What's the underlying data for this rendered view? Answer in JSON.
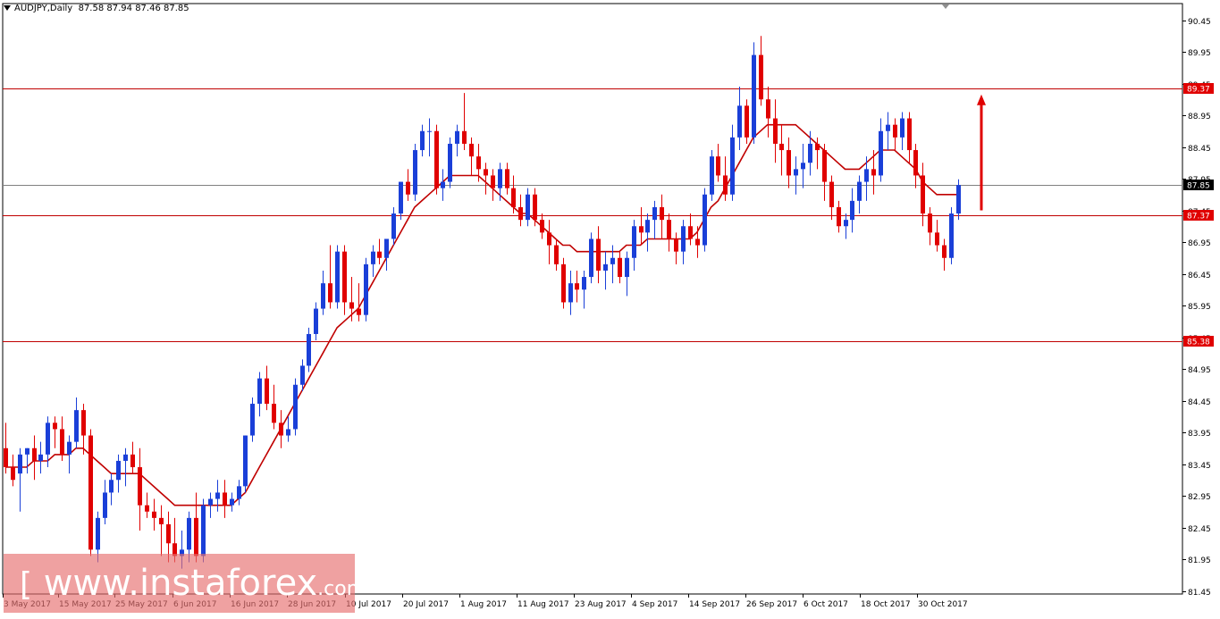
{
  "header": {
    "symbol": "AUDJPY,Daily",
    "ohlc": "87.58 87.94 87.46 87.85"
  },
  "watermark": {
    "open": "[",
    "text": " www.instaforex",
    "suffix": ".com",
    "close": " ]"
  },
  "colors": {
    "bull": "#1a3fd8",
    "bear": "#e00000",
    "level_line": "#c00000",
    "label_bg": "#e00000",
    "ma": "#c00000",
    "price_line": "#808080",
    "arrow": "#e00000"
  },
  "chart_data": {
    "type": "candlestick",
    "symbol": "AUDJPY",
    "timeframe": "Daily",
    "y_range": [
      81.45,
      90.45
    ],
    "y_ticks": [
      "90.45",
      "89.95",
      "89.45",
      "88.95",
      "88.45",
      "87.95",
      "87.45",
      "86.95",
      "86.45",
      "85.95",
      "85.45",
      "84.95",
      "84.45",
      "83.95",
      "83.45",
      "82.95",
      "82.45",
      "81.95",
      "81.45"
    ],
    "x_ticks": [
      "3 May 2017",
      "15 May 2017",
      "25 May 2017",
      "6 Jun 2017",
      "16 Jun 2017",
      "28 Jun 2017",
      "10 Jul 2017",
      "20 Jul 2017",
      "1 Aug 2017",
      "11 Aug 2017",
      "23 Aug 2017",
      "4 Sep 2017",
      "14 Sep 2017",
      "26 Sep 2017",
      "6 Oct 2017",
      "18 Oct 2017",
      "30 Oct 2017"
    ],
    "levels": [
      {
        "value": 89.37,
        "label": "89.37"
      },
      {
        "value": 87.37,
        "label": "87.37"
      },
      {
        "value": 85.38,
        "label": "85.38"
      }
    ],
    "current_price": {
      "value": 87.85,
      "label": "87.85"
    },
    "candles": [
      [
        83.7,
        84.1,
        83.3,
        83.4
      ],
      [
        83.4,
        83.6,
        83.1,
        83.2
      ],
      [
        83.3,
        83.7,
        82.7,
        83.6
      ],
      [
        83.6,
        83.7,
        83.3,
        83.7
      ],
      [
        83.7,
        83.9,
        83.2,
        83.5
      ],
      [
        83.5,
        83.8,
        83.3,
        83.6
      ],
      [
        83.6,
        84.2,
        83.4,
        84.1
      ],
      [
        84.1,
        84.2,
        83.7,
        84.0
      ],
      [
        84.0,
        84.2,
        83.5,
        83.6
      ],
      [
        83.6,
        83.9,
        83.3,
        83.8
      ],
      [
        83.8,
        84.5,
        83.7,
        84.3
      ],
      [
        84.3,
        84.4,
        83.6,
        83.9
      ],
      [
        83.9,
        84.0,
        82.0,
        82.1
      ],
      [
        82.1,
        82.7,
        81.9,
        82.6
      ],
      [
        82.6,
        83.2,
        82.5,
        83.0
      ],
      [
        83.0,
        83.3,
        82.8,
        83.2
      ],
      [
        83.2,
        83.6,
        83.0,
        83.5
      ],
      [
        83.5,
        83.7,
        83.1,
        83.6
      ],
      [
        83.6,
        83.8,
        83.3,
        83.4
      ],
      [
        83.4,
        83.7,
        82.4,
        82.8
      ],
      [
        82.8,
        83.0,
        82.6,
        82.7
      ],
      [
        82.7,
        82.9,
        82.4,
        82.6
      ],
      [
        82.6,
        82.8,
        82.0,
        82.5
      ],
      [
        82.5,
        82.7,
        81.9,
        82.2
      ],
      [
        82.2,
        82.6,
        81.9,
        82.0
      ],
      [
        82.0,
        82.4,
        81.8,
        82.1
      ],
      [
        82.1,
        82.7,
        81.9,
        82.6
      ],
      [
        82.6,
        83.0,
        81.9,
        82.0
      ],
      [
        82.0,
        82.9,
        81.9,
        82.8
      ],
      [
        82.8,
        83.0,
        82.6,
        82.9
      ],
      [
        82.9,
        83.2,
        82.7,
        83.0
      ],
      [
        83.0,
        83.2,
        82.6,
        82.8
      ],
      [
        82.8,
        83.0,
        82.7,
        82.9
      ],
      [
        82.9,
        83.2,
        82.8,
        83.1
      ],
      [
        83.1,
        83.9,
        83.0,
        83.9
      ],
      [
        83.9,
        84.5,
        83.8,
        84.4
      ],
      [
        84.4,
        84.9,
        84.2,
        84.8
      ],
      [
        84.8,
        85.0,
        84.3,
        84.4
      ],
      [
        84.4,
        84.7,
        84.0,
        84.1
      ],
      [
        84.1,
        84.3,
        83.7,
        83.9
      ],
      [
        83.9,
        84.2,
        83.8,
        84.0
      ],
      [
        84.0,
        84.8,
        83.9,
        84.7
      ],
      [
        84.7,
        85.1,
        84.6,
        85.0
      ],
      [
        85.0,
        85.6,
        84.9,
        85.5
      ],
      [
        85.5,
        86.0,
        85.4,
        85.9
      ],
      [
        85.9,
        86.5,
        85.8,
        86.3
      ],
      [
        86.3,
        86.9,
        85.9,
        86.0
      ],
      [
        86.0,
        86.9,
        85.9,
        86.8
      ],
      [
        86.8,
        86.9,
        85.8,
        86.0
      ],
      [
        86.0,
        86.4,
        85.7,
        85.9
      ],
      [
        85.9,
        86.3,
        85.7,
        85.8
      ],
      [
        85.8,
        86.7,
        85.7,
        86.6
      ],
      [
        86.6,
        86.9,
        86.4,
        86.8
      ],
      [
        86.8,
        87.0,
        86.6,
        86.7
      ],
      [
        86.7,
        87.0,
        86.5,
        87.0
      ],
      [
        87.0,
        87.5,
        86.9,
        87.4
      ],
      [
        87.4,
        87.9,
        87.3,
        87.9
      ],
      [
        87.9,
        88.1,
        87.6,
        87.7
      ],
      [
        87.7,
        88.5,
        87.6,
        88.4
      ],
      [
        88.4,
        88.8,
        88.3,
        88.7
      ],
      [
        88.7,
        88.9,
        88.3,
        88.7
      ],
      [
        88.7,
        88.8,
        87.7,
        87.8
      ],
      [
        87.8,
        88.1,
        87.6,
        87.9
      ],
      [
        87.9,
        88.6,
        87.8,
        88.5
      ],
      [
        88.5,
        88.8,
        88.3,
        88.7
      ],
      [
        88.7,
        89.3,
        88.4,
        88.5
      ],
      [
        88.5,
        88.6,
        88.0,
        88.3
      ],
      [
        88.3,
        88.5,
        87.9,
        88.1
      ],
      [
        88.1,
        88.2,
        87.7,
        88.0
      ],
      [
        88.0,
        88.1,
        87.6,
        87.8
      ],
      [
        87.8,
        88.2,
        87.6,
        88.1
      ],
      [
        88.1,
        88.2,
        87.7,
        87.8
      ],
      [
        87.8,
        88.0,
        87.4,
        87.5
      ],
      [
        87.5,
        87.7,
        87.2,
        87.3
      ],
      [
        87.3,
        87.8,
        87.2,
        87.7
      ],
      [
        87.7,
        87.8,
        87.2,
        87.3
      ],
      [
        87.3,
        87.4,
        87.0,
        87.1
      ],
      [
        87.1,
        87.3,
        86.6,
        86.9
      ],
      [
        86.9,
        87.0,
        86.5,
        86.6
      ],
      [
        86.6,
        86.7,
        85.9,
        86.0
      ],
      [
        86.0,
        86.5,
        85.8,
        86.3
      ],
      [
        86.3,
        86.5,
        86.0,
        86.2
      ],
      [
        86.2,
        86.5,
        85.9,
        86.4
      ],
      [
        86.4,
        87.1,
        86.3,
        87.0
      ],
      [
        87.0,
        87.2,
        86.3,
        86.5
      ],
      [
        86.5,
        86.8,
        86.2,
        86.6
      ],
      [
        86.6,
        86.9,
        86.3,
        86.7
      ],
      [
        86.7,
        86.8,
        86.3,
        86.4
      ],
      [
        86.4,
        86.8,
        86.1,
        86.7
      ],
      [
        86.7,
        87.3,
        86.5,
        87.2
      ],
      [
        87.2,
        87.5,
        86.9,
        87.1
      ],
      [
        87.1,
        87.4,
        86.8,
        87.3
      ],
      [
        87.3,
        87.6,
        87.0,
        87.5
      ],
      [
        87.5,
        87.7,
        87.0,
        87.3
      ],
      [
        87.3,
        87.4,
        86.8,
        87.0
      ],
      [
        87.0,
        87.1,
        86.6,
        86.8
      ],
      [
        86.8,
        87.3,
        86.6,
        87.2
      ],
      [
        87.2,
        87.4,
        86.9,
        87.0
      ],
      [
        87.0,
        87.2,
        86.7,
        86.9
      ],
      [
        86.9,
        87.8,
        86.8,
        87.7
      ],
      [
        87.7,
        88.4,
        87.6,
        88.3
      ],
      [
        88.3,
        88.5,
        87.9,
        88.0
      ],
      [
        88.0,
        88.3,
        87.6,
        87.7
      ],
      [
        87.7,
        88.8,
        87.6,
        88.6
      ],
      [
        88.6,
        89.4,
        88.4,
        89.1
      ],
      [
        89.1,
        89.2,
        88.5,
        88.6
      ],
      [
        88.6,
        90.1,
        88.5,
        89.9
      ],
      [
        89.9,
        90.2,
        89.1,
        89.2
      ],
      [
        89.2,
        89.4,
        88.6,
        88.9
      ],
      [
        88.9,
        89.2,
        88.2,
        88.5
      ],
      [
        88.5,
        88.8,
        88.0,
        88.4
      ],
      [
        88.4,
        88.6,
        87.8,
        88.0
      ],
      [
        88.0,
        88.3,
        87.7,
        88.1
      ],
      [
        88.1,
        88.5,
        87.8,
        88.2
      ],
      [
        88.2,
        88.7,
        88.0,
        88.5
      ],
      [
        88.5,
        88.6,
        88.1,
        88.4
      ],
      [
        88.4,
        88.5,
        87.6,
        87.9
      ],
      [
        87.9,
        88.0,
        87.3,
        87.5
      ],
      [
        87.5,
        87.6,
        87.1,
        87.2
      ],
      [
        87.2,
        87.4,
        87.0,
        87.3
      ],
      [
        87.3,
        87.8,
        87.1,
        87.6
      ],
      [
        87.6,
        88.0,
        87.4,
        87.9
      ],
      [
        87.9,
        88.3,
        87.6,
        88.1
      ],
      [
        88.1,
        88.4,
        87.7,
        88.0
      ],
      [
        88.0,
        88.9,
        87.9,
        88.7
      ],
      [
        88.7,
        89.0,
        88.4,
        88.8
      ],
      [
        88.8,
        88.9,
        88.4,
        88.6
      ],
      [
        88.6,
        89.0,
        88.4,
        88.9
      ],
      [
        88.9,
        89.0,
        88.2,
        88.4
      ],
      [
        88.4,
        88.5,
        87.8,
        88.0
      ],
      [
        88.0,
        88.2,
        87.2,
        87.4
      ],
      [
        87.4,
        87.5,
        86.9,
        87.1
      ],
      [
        87.1,
        87.3,
        86.8,
        86.9
      ],
      [
        86.9,
        87.0,
        86.5,
        86.7
      ],
      [
        86.7,
        87.5,
        86.6,
        87.4
      ],
      [
        87.4,
        87.94,
        87.3,
        87.85
      ]
    ],
    "moving_average": {
      "name": "",
      "color": "#c00000",
      "values": [
        83.4,
        83.4,
        83.4,
        83.4,
        83.5,
        83.5,
        83.5,
        83.6,
        83.6,
        83.6,
        83.7,
        83.7,
        83.6,
        83.5,
        83.4,
        83.3,
        83.3,
        83.3,
        83.3,
        83.3,
        83.2,
        83.1,
        83.0,
        82.9,
        82.8,
        82.8,
        82.8,
        82.8,
        82.8,
        82.8,
        82.8,
        82.8,
        82.8,
        82.9,
        83.0,
        83.2,
        83.4,
        83.6,
        83.8,
        84.0,
        84.2,
        84.4,
        84.6,
        84.8,
        85.0,
        85.2,
        85.4,
        85.6,
        85.7,
        85.8,
        85.9,
        86.1,
        86.3,
        86.5,
        86.7,
        86.9,
        87.1,
        87.3,
        87.5,
        87.6,
        87.7,
        87.8,
        87.9,
        88.0,
        88.0,
        88.0,
        88.0,
        88.0,
        87.9,
        87.8,
        87.7,
        87.6,
        87.5,
        87.4,
        87.4,
        87.3,
        87.2,
        87.1,
        87.0,
        86.9,
        86.9,
        86.8,
        86.8,
        86.8,
        86.8,
        86.8,
        86.8,
        86.8,
        86.9,
        86.9,
        86.9,
        87.0,
        87.0,
        87.0,
        87.0,
        87.0,
        87.0,
        87.0,
        87.1,
        87.3,
        87.5,
        87.6,
        87.8,
        88.0,
        88.2,
        88.4,
        88.6,
        88.7,
        88.8,
        88.8,
        88.8,
        88.8,
        88.8,
        88.7,
        88.6,
        88.5,
        88.4,
        88.3,
        88.2,
        88.1,
        88.1,
        88.1,
        88.2,
        88.3,
        88.4,
        88.4,
        88.4,
        88.3,
        88.2,
        88.1,
        87.9,
        87.8,
        87.7,
        87.7,
        87.7,
        87.7
      ]
    },
    "arrow": {
      "direction": "up",
      "from": 87.45,
      "to": 89.25
    },
    "grid": false
  }
}
